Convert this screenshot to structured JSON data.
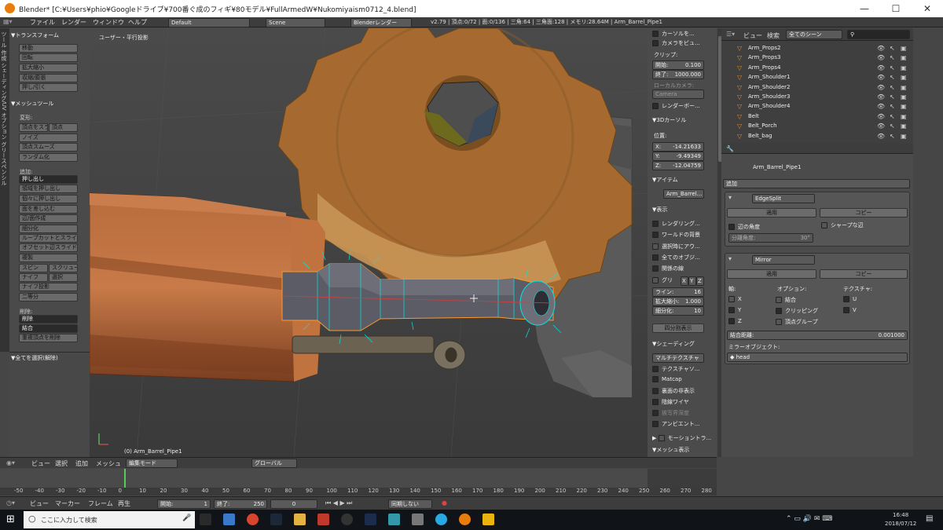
{
  "window": {
    "title": "Blender* [C:¥Users¥phio¥Googleドライブ¥700番ぐ成のフィギ¥80モデル¥FullArmedW¥Nukomiyaism0712_4.blend]"
  },
  "info_header": {
    "menus": [
      "ファイル",
      "レンダー",
      "ウィンドウ",
      "ヘルプ"
    ],
    "layout": "Default",
    "scene": "Scene",
    "engine": "Blenderレンダー",
    "stats": "v2.79 | 頂点:0/72 | 面:0/136 | 三角:64 | 三角面:128 | メモリ:28.64M | Arm_Barrel_Pipe1"
  },
  "tool_shelf": {
    "vertical_tabs": "ツール 作成 シェーディング/UV オプション グリースペンシル",
    "transform_header": "▼トランスフォーム",
    "transform_buttons": [
      "移動",
      "回転",
      "拡大縮小",
      "収縮/膨張",
      "押し/引く"
    ],
    "mesh_tools_header": "▼メッシュツール",
    "deform_label": "変形:",
    "deform_buttons": [
      "なめらか",
      "ノイズ",
      "頂点スムーズ",
      "ランダム化"
    ],
    "deform_row": [
      "頂点をスライド",
      "頂点"
    ],
    "add_label": "追加:",
    "extrude_select": "押し出し",
    "add_buttons": [
      "領域を押し出し",
      "個々に押し出し",
      "面を差し込む",
      "辺/面作成",
      "細分化",
      "ループカットとスライド",
      "オフセット辺スライド",
      "複製"
    ],
    "spin_row": [
      "スピン",
      "スクリュー"
    ],
    "knife_row": [
      "ナイフ",
      "選択"
    ],
    "more_buttons": [
      "ナイフ投影",
      "二等分"
    ],
    "remove_label": "削除:",
    "remove_buttons": [
      "削除",
      "結合",
      "重複頂点を削除"
    ],
    "operator_header": "▼全てを選択(解除)"
  },
  "viewport": {
    "view_label": "ユーザー・平行投影",
    "object_label": "(0) Arm_Barrel_Pipe1",
    "header": {
      "menus": [
        "ビュー",
        "選択",
        "追加",
        "メッシュ"
      ],
      "mode": "編集モード",
      "orientation": "グローバル"
    }
  },
  "n_panel": {
    "camera_lock": "カーソルを...",
    "camera_view": "カメラをビュ...",
    "clip_label": "クリップ:",
    "clip_start_label": "開始:",
    "clip_start": "0.100",
    "clip_end_label": "終了:",
    "clip_end": "1000.000",
    "local_camera_label": "ローカルカメラ:",
    "local_camera": "Camera",
    "render_border": "レンダーボー...",
    "cursor_header": "▼3Dカーソル",
    "location_label": "位置:",
    "cursor_x": "-14.21633",
    "cursor_y": "-9.49349",
    "cursor_z": "-12.04759",
    "item_header": "▼アイテム",
    "item_name": "Arm_Barrel...",
    "display_header": "▼表示",
    "display_opts": [
      "レンダリング...",
      "ワールドの背景",
      "選択時にアウ...",
      "全てのオブジ...",
      "関係の線"
    ],
    "grid_label": "グリ",
    "grid_axes": [
      "X",
      "Y",
      "Z"
    ],
    "lines_label": "ライン:",
    "lines": "16",
    "scale_label": "拡大縮小:",
    "scale": "1.000",
    "subdiv_label": "細分化:",
    "subdiv": "10",
    "quad_view": "四分割表示",
    "shading_header": "▼シェーディング",
    "shading_mode": "マルチテクスチャ",
    "shading_opts": [
      "テクスチャソ...",
      "Matcap",
      "裏面の非表示",
      "陰線ワイヤ",
      "被写界深度",
      "アンビエント..."
    ],
    "motion_tracking": "モーショントラ...",
    "mesh_display": "▼メッシュ表示"
  },
  "outliner": {
    "menus": [
      "ビュー",
      "検索"
    ],
    "filter": "全てのシーン",
    "items": [
      "Arm_Props2",
      "Arm_Props3",
      "Arm_Props4",
      "Arm_Shoulder1",
      "Arm_Shoulder2",
      "Arm_Shoulder3",
      "Arm_Shoulder4",
      "Belt",
      "Belt_Porch",
      "Belt_bag"
    ]
  },
  "properties": {
    "breadcrumb": "Arm_Barrel_Pipe1",
    "add_modifier": "追加",
    "edgesplit": {
      "name": "EdgeSplit",
      "apply": "適用",
      "copy": "コピー",
      "edge_angle": "辺の角度",
      "sharp_edges": "シャープな辺",
      "split_angle": "分離角度:",
      "split_angle_value": "30°"
    },
    "mirror": {
      "name": "Mirror",
      "apply": "適用",
      "copy": "コピー",
      "axis_label": "軸:",
      "options_label": "オプション:",
      "texture_label": "テクスチャ:",
      "axes": [
        "X",
        "Y",
        "Z"
      ],
      "opts": [
        "結合",
        "クリッピング",
        "頂点グループ"
      ],
      "tex": [
        "U",
        "V"
      ],
      "merge_label": "結合距離:",
      "merge_value": "0.001000",
      "mirror_obj_label": "ミラーオブジェクト:",
      "mirror_obj": "head"
    }
  },
  "timeline": {
    "header_menus": [
      "ビュー",
      "マーカー",
      "フレーム",
      "再生"
    ],
    "start_label": "開始:",
    "start": "1",
    "end_label": "終了:",
    "end": "250",
    "current": "0",
    "sync": "同期しない",
    "ticks": [
      "-50",
      "-40",
      "-30",
      "-20",
      "-10",
      "0",
      "10",
      "20",
      "30",
      "40",
      "50",
      "60",
      "70",
      "80",
      "90",
      "100",
      "110",
      "120",
      "130",
      "140",
      "150",
      "160",
      "170",
      "180",
      "190",
      "200",
      "210",
      "220",
      "230",
      "240",
      "250",
      "260",
      "270",
      "280"
    ]
  },
  "taskbar": {
    "search_placeholder": "ここに入力して検索",
    "time": "16:48",
    "date": "2018/07/12"
  }
}
